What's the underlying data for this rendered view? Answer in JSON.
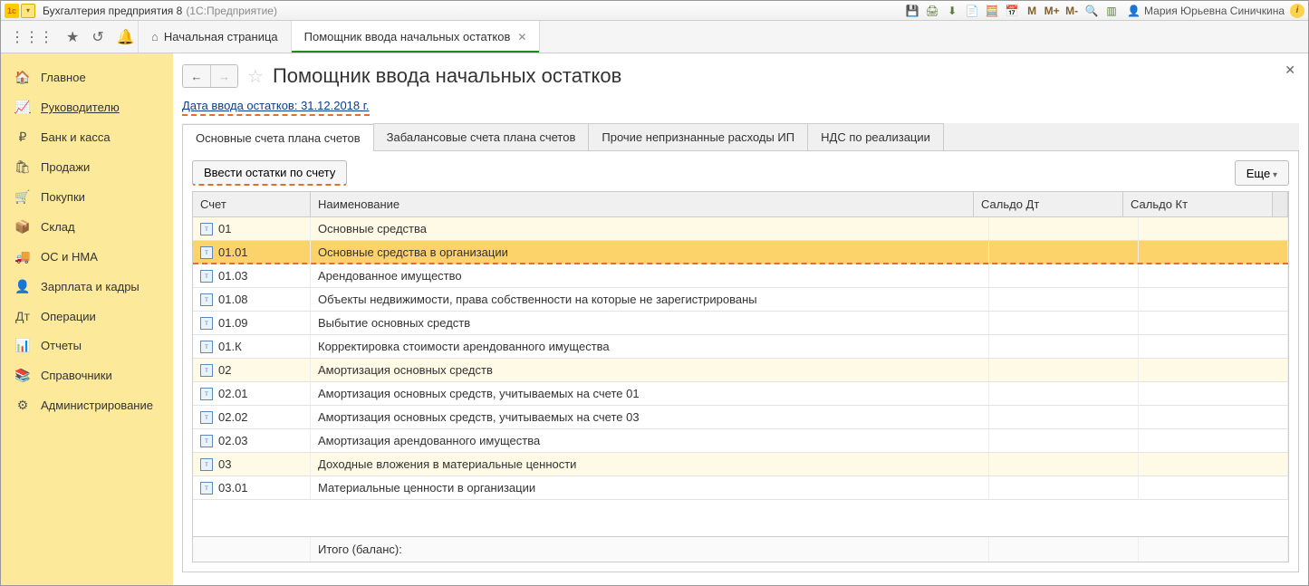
{
  "titlebar": {
    "app_title": "Бухгалтерия предприятия 8",
    "app_sub": "(1С:Предприятие)",
    "user_name": "Мария Юрьевна Синичкина",
    "m_labels": [
      "M",
      "M+",
      "M-"
    ]
  },
  "tabs": {
    "home": "Начальная страница",
    "active": "Помощник ввода начальных остатков"
  },
  "sidebar": {
    "items": [
      {
        "icon": "🏠",
        "label": "Главное"
      },
      {
        "icon": "📈",
        "label": "Руководителю",
        "underline": true
      },
      {
        "icon": "₽",
        "label": "Банк и касса"
      },
      {
        "icon": "🛍",
        "label": "Продажи"
      },
      {
        "icon": "🛒",
        "label": "Покупки"
      },
      {
        "icon": "📦",
        "label": "Склад"
      },
      {
        "icon": "🚚",
        "label": "ОС и НМА"
      },
      {
        "icon": "👤",
        "label": "Зарплата и кадры"
      },
      {
        "icon": "Дт",
        "label": "Операции"
      },
      {
        "icon": "📊",
        "label": "Отчеты"
      },
      {
        "icon": "📚",
        "label": "Справочники"
      },
      {
        "icon": "⚙",
        "label": "Администрирование"
      }
    ]
  },
  "page": {
    "title": "Помощник ввода начальных остатков",
    "date_link": "Дата ввода остатков: 31.12.2018 г.",
    "subtabs": [
      "Основные счета плана счетов",
      "Забалансовые счета плана счетов",
      "Прочие непризнанные расходы ИП",
      "НДС по реализации"
    ],
    "enter_btn": "Ввести остатки по счету",
    "more_btn": "Еще",
    "grid": {
      "headers": {
        "acc": "Счет",
        "name": "Наименование",
        "dt": "Сальдо Дт",
        "kt": "Сальдо Кт"
      },
      "rows": [
        {
          "acc": "01",
          "name": "Основные средства",
          "group": true
        },
        {
          "acc": "01.01",
          "name": "Основные средства в организации",
          "selected": true,
          "group": true
        },
        {
          "acc": "01.03",
          "name": "Арендованное имущество"
        },
        {
          "acc": "01.08",
          "name": "Объекты недвижимости, права собственности на которые не зарегистрированы"
        },
        {
          "acc": "01.09",
          "name": "Выбытие основных средств"
        },
        {
          "acc": "01.К",
          "name": "Корректировка стоимости арендованного имущества"
        },
        {
          "acc": "02",
          "name": "Амортизация основных средств",
          "group": true
        },
        {
          "acc": "02.01",
          "name": "Амортизация основных средств, учитываемых на счете 01"
        },
        {
          "acc": "02.02",
          "name": "Амортизация основных средств, учитываемых на счете 03"
        },
        {
          "acc": "02.03",
          "name": "Амортизация арендованного имущества"
        },
        {
          "acc": "03",
          "name": "Доходные вложения в материальные ценности",
          "group": true
        },
        {
          "acc": "03.01",
          "name": "Материальные ценности в организации"
        }
      ],
      "footer": "Итого (баланс):"
    }
  }
}
